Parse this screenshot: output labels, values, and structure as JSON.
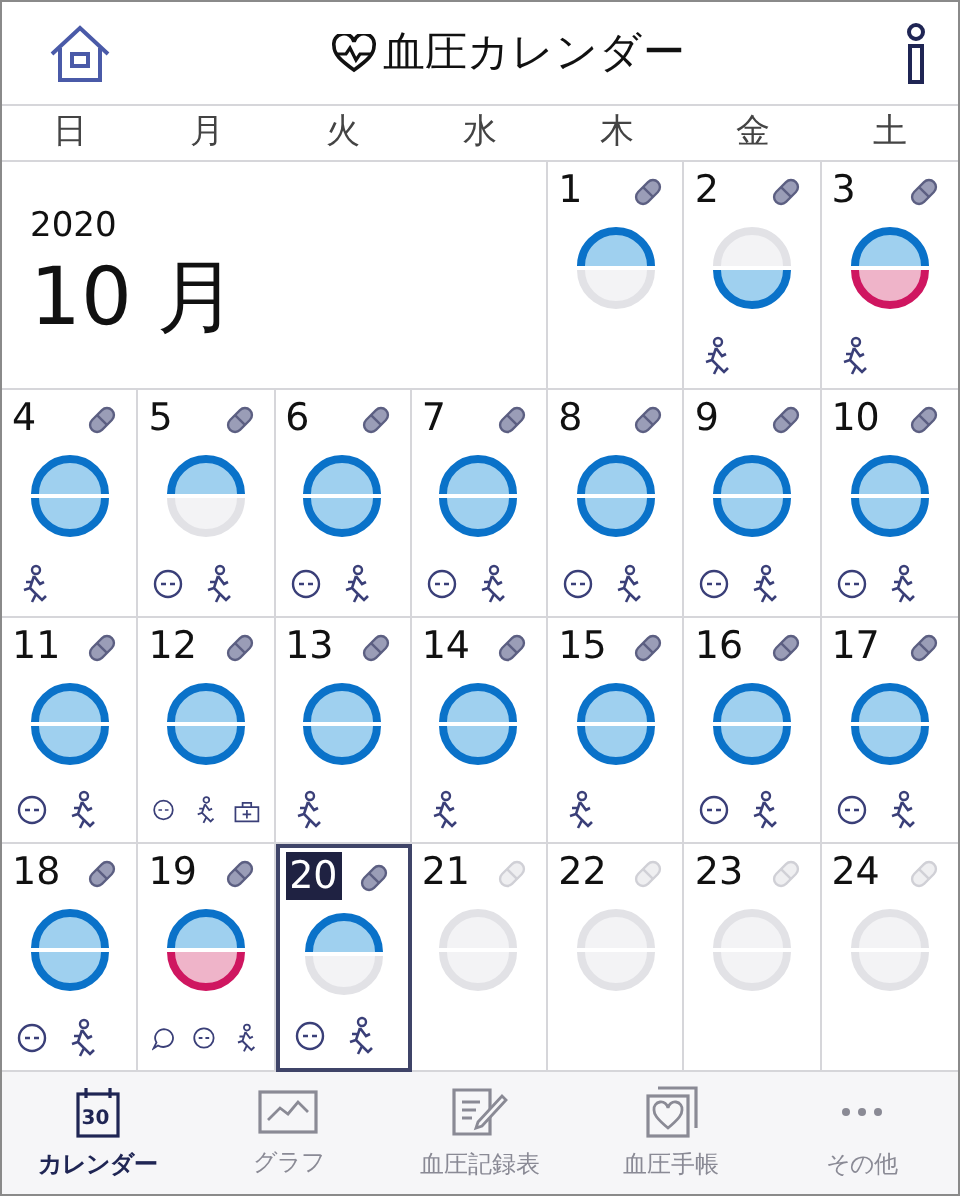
{
  "header": {
    "title": "血圧カレンダー"
  },
  "weekdays": [
    "日",
    "月",
    "火",
    "水",
    "木",
    "金",
    "土"
  ],
  "month_block": {
    "year": "2020",
    "month": "10 月"
  },
  "days": [
    {
      "day": "1",
      "pill": true,
      "morning_recorded": true,
      "morning_high": false,
      "evening_recorded": false,
      "selected": false
    },
    {
      "day": "2",
      "pill": true,
      "morning_recorded": false,
      "evening_recorded": true,
      "evening_high": false,
      "exercise": true,
      "selected": false
    },
    {
      "day": "3",
      "pill": true,
      "morning_recorded": true,
      "morning_high": false,
      "evening_recorded": true,
      "evening_high": true,
      "exercise": true,
      "selected": false
    },
    {
      "day": "4",
      "pill": true,
      "morning_recorded": true,
      "morning_high": false,
      "evening_recorded": true,
      "evening_high": false,
      "exercise": true,
      "selected": false
    },
    {
      "day": "5",
      "pill": true,
      "morning_recorded": true,
      "morning_high": false,
      "evening_recorded": false,
      "mood": true,
      "exercise": true,
      "selected": false
    },
    {
      "day": "6",
      "pill": true,
      "morning_recorded": true,
      "morning_high": false,
      "evening_recorded": true,
      "evening_high": false,
      "mood": true,
      "exercise": true,
      "selected": false
    },
    {
      "day": "7",
      "pill": true,
      "morning_recorded": true,
      "morning_high": false,
      "evening_recorded": true,
      "evening_high": false,
      "mood": true,
      "exercise": true,
      "selected": false
    },
    {
      "day": "8",
      "pill": true,
      "morning_recorded": true,
      "morning_high": false,
      "evening_recorded": true,
      "evening_high": false,
      "mood": true,
      "exercise": true,
      "selected": false
    },
    {
      "day": "9",
      "pill": true,
      "morning_recorded": true,
      "morning_high": false,
      "evening_recorded": true,
      "evening_high": false,
      "mood": true,
      "exercise": true,
      "selected": false
    },
    {
      "day": "10",
      "pill": true,
      "morning_recorded": true,
      "morning_high": false,
      "evening_recorded": true,
      "evening_high": false,
      "mood": true,
      "exercise": true,
      "selected": false
    },
    {
      "day": "11",
      "pill": true,
      "morning_recorded": true,
      "morning_high": false,
      "evening_recorded": true,
      "evening_high": false,
      "mood": true,
      "exercise": true,
      "selected": false
    },
    {
      "day": "12",
      "pill": true,
      "morning_recorded": true,
      "morning_high": false,
      "evening_recorded": true,
      "evening_high": false,
      "mood": true,
      "exercise": true,
      "hospital": true,
      "selected": false
    },
    {
      "day": "13",
      "pill": true,
      "morning_recorded": true,
      "morning_high": false,
      "evening_recorded": true,
      "evening_high": false,
      "exercise": true,
      "selected": false
    },
    {
      "day": "14",
      "pill": true,
      "morning_recorded": true,
      "morning_high": false,
      "evening_recorded": true,
      "evening_high": false,
      "exercise": true,
      "selected": false
    },
    {
      "day": "15",
      "pill": true,
      "morning_recorded": true,
      "morning_high": false,
      "evening_recorded": true,
      "evening_high": false,
      "exercise": true,
      "selected": false
    },
    {
      "day": "16",
      "pill": true,
      "morning_recorded": true,
      "morning_high": false,
      "evening_recorded": true,
      "evening_high": false,
      "mood": true,
      "exercise": true,
      "selected": false
    },
    {
      "day": "17",
      "pill": true,
      "morning_recorded": true,
      "morning_high": false,
      "evening_recorded": true,
      "evening_high": false,
      "mood": true,
      "exercise": true,
      "selected": false
    },
    {
      "day": "18",
      "pill": true,
      "morning_recorded": true,
      "morning_high": false,
      "evening_recorded": true,
      "evening_high": false,
      "mood": true,
      "exercise": true,
      "selected": false
    },
    {
      "day": "19",
      "pill": true,
      "morning_recorded": true,
      "morning_high": false,
      "evening_recorded": true,
      "evening_high": true,
      "comment": true,
      "mood": true,
      "exercise": true,
      "selected": false
    },
    {
      "day": "20",
      "pill": true,
      "morning_recorded": true,
      "morning_high": false,
      "evening_recorded": false,
      "mood": true,
      "exercise": true,
      "selected": true
    },
    {
      "day": "21",
      "pill": false,
      "morning_recorded": false,
      "evening_recorded": false,
      "selected": false
    },
    {
      "day": "22",
      "pill": false,
      "morning_recorded": false,
      "evening_recorded": false,
      "selected": false
    },
    {
      "day": "23",
      "pill": false,
      "morning_recorded": false,
      "evening_recorded": false,
      "selected": false
    },
    {
      "day": "24",
      "pill": false,
      "morning_recorded": false,
      "evening_recorded": false,
      "selected": false
    }
  ],
  "tabs": [
    {
      "label": "カレンダー",
      "kind": "calendar",
      "icon_text": "30",
      "selected": true
    },
    {
      "label": "グラフ",
      "kind": "graph",
      "selected": false
    },
    {
      "label": "血圧記録表",
      "kind": "record",
      "selected": false
    },
    {
      "label": "血圧手帳",
      "kind": "notebook",
      "selected": false
    },
    {
      "label": "その他",
      "kind": "more",
      "selected": false
    }
  ]
}
